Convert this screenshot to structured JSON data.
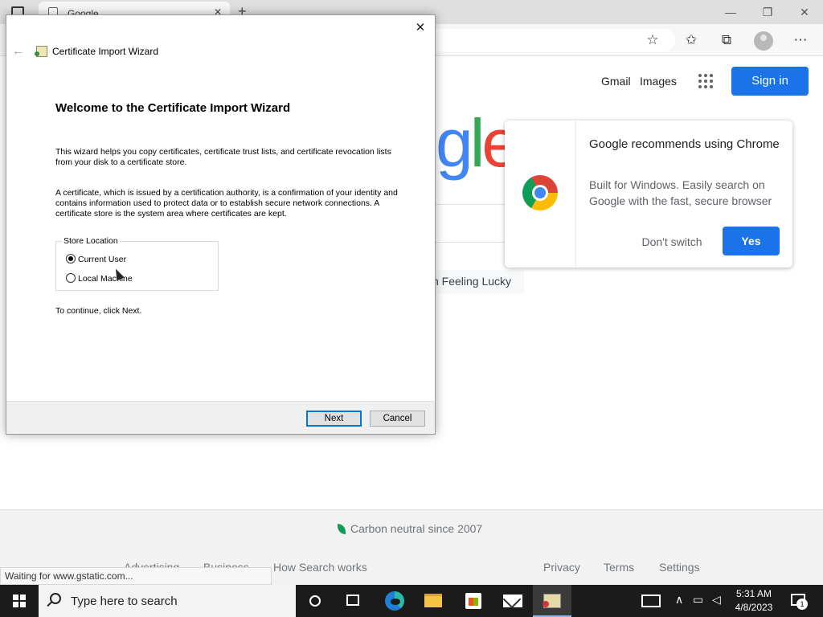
{
  "browser": {
    "tab_title": "Google",
    "new_tab_glyph": "+",
    "window_controls": {
      "minimize": "—",
      "restore": "❐",
      "close": "✕"
    }
  },
  "google": {
    "links": {
      "gmail": "Gmail",
      "images": "Images"
    },
    "sign_in": "Sign in",
    "logo_fragment": [
      "g",
      "l",
      "e"
    ],
    "logo_colors": [
      "#4285f4",
      "#34a853",
      "#ea4335"
    ],
    "lucky_button": "n Feeling Lucky",
    "promo": {
      "title": "Google recommends using Chrome",
      "text": "Built for Windows. Easily search on Google with the fast, secure browser",
      "dont_switch": "Don't switch",
      "yes": "Yes"
    },
    "footer": {
      "carbon": "Carbon neutral since 2007",
      "left_links": [
        "Advertising",
        "Business",
        "How Search works"
      ],
      "right_links": [
        "Privacy",
        "Terms",
        "Settings"
      ]
    },
    "status_bar": "Waiting for www.gstatic.com..."
  },
  "wizard": {
    "title": "Certificate Import Wizard",
    "close_glyph": "✕",
    "back_glyph": "←",
    "heading": "Welcome to the Certificate Import Wizard",
    "para1": "This wizard helps you copy certificates, certificate trust lists, and certificate revocation lists from your disk to a certificate store.",
    "para2": "A certificate, which is issued by a certification authority, is a confirmation of your identity and contains information used to protect data or to establish secure network connections. A certificate store is the system area where certificates are kept.",
    "store_location": {
      "legend": "Store Location",
      "options": [
        "Current User",
        "Local Machine"
      ],
      "selected": "Current User"
    },
    "continue_text": "To continue, click Next.",
    "next_button": "Next",
    "cancel_button": "Cancel"
  },
  "taskbar": {
    "search_placeholder": "Type here to search",
    "time": "5:31 AM",
    "date": "4/8/2023",
    "notification_count": "1"
  }
}
